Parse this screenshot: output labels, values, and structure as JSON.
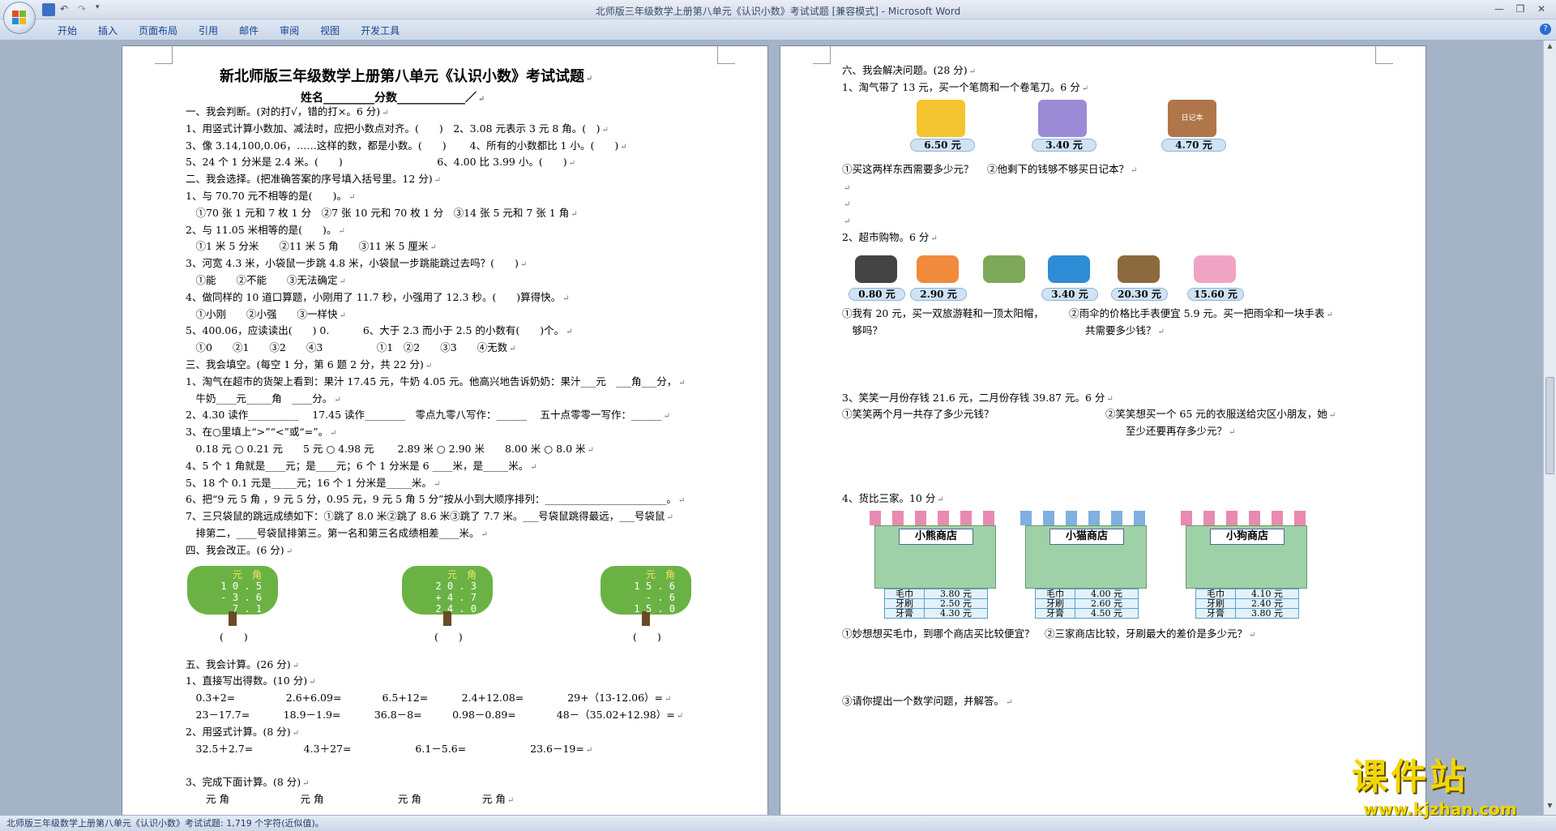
{
  "window": {
    "title": "北师版三年级数学上册第八单元《认识小数》考试试题 [兼容模式] - Microsoft Word",
    "accent": "#15428b"
  },
  "ribbon": {
    "tabs": [
      "开始",
      "插入",
      "页面布局",
      "引用",
      "邮件",
      "审阅",
      "视图",
      "开发工具"
    ]
  },
  "status": {
    "text": "北师版三年级数学上册第八单元《认识小数》考试试题: 1,719 个字符(近似值)。"
  },
  "left_page": {
    "title": "新北师版三年级数学上册第八单元《认识小数》考试试题",
    "subtitle": "姓名_________分数____________／",
    "lines": [
      "一、我会判断。(对的打√，错的打×。6 分)",
      "1、用竖式计算小数加、减法时，应把小数点对齐。(　　)　2、3.08 元表示 3 元 8 角。(　)",
      "3、像 3.14,100,0.06，……这样的数，都是小数。(　　)　　 4、所有的小数都比 1 小。(　　)",
      "5、24 个 1 分米是 2.4 米。(　　)　　　　　　　　　 6、4.00 比 3.99 小。(　　)",
      "二、我会选择。(把准确答案的序号填入括号里。12 分)",
      "1、与 70.70 元不相等的是(　　)。",
      "　①70 张 1 元和 7 枚 1 分　②7 张 10 元和 70 枚 1 分　③14 张 5 元和 7 张 1 角",
      "2、与 11.05 米相等的是(　　)。",
      "　①1 米 5 分米　　②11 米 5 角　　③11 米 5 厘米",
      "3、河宽 4.3 米，小袋鼠一步跳 4.8 米，小袋鼠一步跳能跳过去吗？(　　)",
      "　①能　　②不能　　③无法确定",
      "4、做同样的 10 道口算题，小刚用了 11.7 秒，小强用了 12.3 秒。(　　)算得快。",
      "　①小刚　　②小强　　③一样快",
      "5、400.06，应读读出(　　) 0.　　　 6、大于 2.3 而小于 2.5 的小数有(　　)个。",
      "　①0　　②1　　③2　　④3　　　　　 ①1　②2　　③3　　④无数",
      "三、我会填空。(每空 1 分，第 6 题 2 分，共 22 分)",
      "1、淘气在超市的货架上看到：果汁 17.45 元，牛奶 4.05 元。他高兴地告诉奶奶：果汁___元　___角___分，",
      "　牛奶____元_____角　____分。",
      "2、4.30 读作__________　 17.45 读作________　零点九零八写作：______　 五十点零零一写作：______",
      "3、在○里填上“>”“<”或“=”。",
      "　0.18 元 ○ 0.21 元　　5 元 ○ 4.98 元　　 2.89 米 ○ 2.90 米　　8.00 米 ○ 8.0 米",
      "4、5 个 1 角就是____元；是____元；6 个 1 分米是 6 ____米，是_____米。",
      "5、18 个 0.1 元是_____元；16 个 1 分米是_____米。",
      "6、把“9 元 5 角 ，9 元 5 分，0.95 元，9 元 5 角 5 分”按从小到大顺序排列：________________________。",
      "7、三只袋鼠的跳远成绩如下：①跳了 8.0 米②跳了 8.6 米③跳了 7.7 米。___号袋鼠跳得最远，___号袋鼠",
      "　排第二，____号袋鼠排第三。第一名和第三名成绩相差____米。",
      "四、我会改正。(6 分)"
    ],
    "trees": [
      {
        "header": "元　角",
        "rows": [
          "1 0 . 5",
          "-  3 . 6",
          "  7 . 1"
        ],
        "answer": "(　　)"
      },
      {
        "header": "元　角",
        "rows": [
          "2 0 . 3",
          "+  4 . 7",
          "2 4 . 0"
        ],
        "answer": "(　　)"
      },
      {
        "header": "元　角",
        "rows": [
          "1 5 . 6",
          "-   . 6",
          "1 5 . 0"
        ],
        "answer": "(　　)"
      }
    ],
    "lines2": [
      "五、我会计算。(26 分)",
      "1、直接写出得数。(10 分)",
      "　0.3+2=　　　　　2.6+6.09=　　　　6.5+12=　　　 2.4+12.08=　　　　 29+（13-12.06）=",
      "　23－17.7=　　　 18.9－1.9=　　　 36.8－8=　　　0.98－0.89=　　　　48－（35.02+12.98）=",
      "2、用竖式计算。(8 分)",
      "　32.5＋2.7=　　　　　4.3＋27=　　　　　　 6.1－5.6=　　　　　　 23.6－19=",
      "",
      "3、完成下面计算。(8 分)",
      "　　元 角　　　　　　　元 角　　　　　　　 元 角　　　　　　元 角"
    ]
  },
  "right_page": {
    "lines": [
      "六、我会解决问题。(28 分)",
      "1、淘气带了 13 元，买一个笔筒和一个卷笔刀。6 分"
    ],
    "items1": [
      {
        "icon": "pen-holder-icon",
        "price": "6.50 元"
      },
      {
        "icon": "pencil-sharpener-icon",
        "price": "3.40 元"
      },
      {
        "icon": "notebook-icon",
        "label": "日记本",
        "price": "4.70 元"
      }
    ],
    "lines_b": [
      "①买这两样东西需要多少元？　 ②他剩下的钱够不够买日记本？",
      "2、超市购物。6 分"
    ],
    "items2": [
      {
        "icon": "battery-icon",
        "price": "0.80 元"
      },
      {
        "icon": "cap-icon",
        "price": "2.90 元"
      },
      {
        "icon": "umbrella-icon",
        "price": ""
      },
      {
        "icon": "flashlight-icon",
        "price": "3.40 元"
      },
      {
        "icon": "watch-icon",
        "price": "20.30 元"
      },
      {
        "icon": "shoes-icon",
        "price": "15.60 元"
      }
    ],
    "lines_c": [
      "①我有 20 元，买一双旅游鞋和一顶太阳帽，　　　②雨伞的价格比手表便宜 5.9 元。买一把雨伞和一块手表",
      "　够吗？　　　　　　　　　　　　　　　　　　　　共需要多少钱？",
      "3、笑笑一月份存钱 21.6 元，二月份存钱 39.87 元。6 分",
      "①笑笑两个月一共存了多少元钱？　　　　　　　　　　　②笑笑想买一个 65 元的衣服送给灾区小朋友，她",
      "　　　　　　　　　　　　　　　　　　　　　　　　　　　　至少还要再存多少元？",
      "4、货比三家。10 分"
    ],
    "shops": [
      {
        "name": "小熊商店",
        "rows": [
          [
            "毛巾",
            "3.80 元"
          ],
          [
            "牙刷",
            "2.50 元"
          ],
          [
            "牙膏",
            "4.30 元"
          ]
        ]
      },
      {
        "name": "小猫商店",
        "rows": [
          [
            "毛巾",
            "4.00 元"
          ],
          [
            "牙刷",
            "2.60 元"
          ],
          [
            "牙膏",
            "4.50 元"
          ]
        ]
      },
      {
        "name": "小狗商店",
        "rows": [
          [
            "毛巾",
            "4.10 元"
          ],
          [
            "牙刷",
            "2.40 元"
          ],
          [
            "牙膏",
            "3.80 元"
          ]
        ]
      }
    ],
    "lines_d": [
      "①妙想想买毛巾，到哪个商店买比较便宜？　②三家商店比较，牙刷最大的差价是多少元？",
      "③请你提出一个数学问题，并解答。"
    ]
  },
  "watermark": {
    "cn": "课件站",
    "url": "www.kjzhan.com"
  }
}
